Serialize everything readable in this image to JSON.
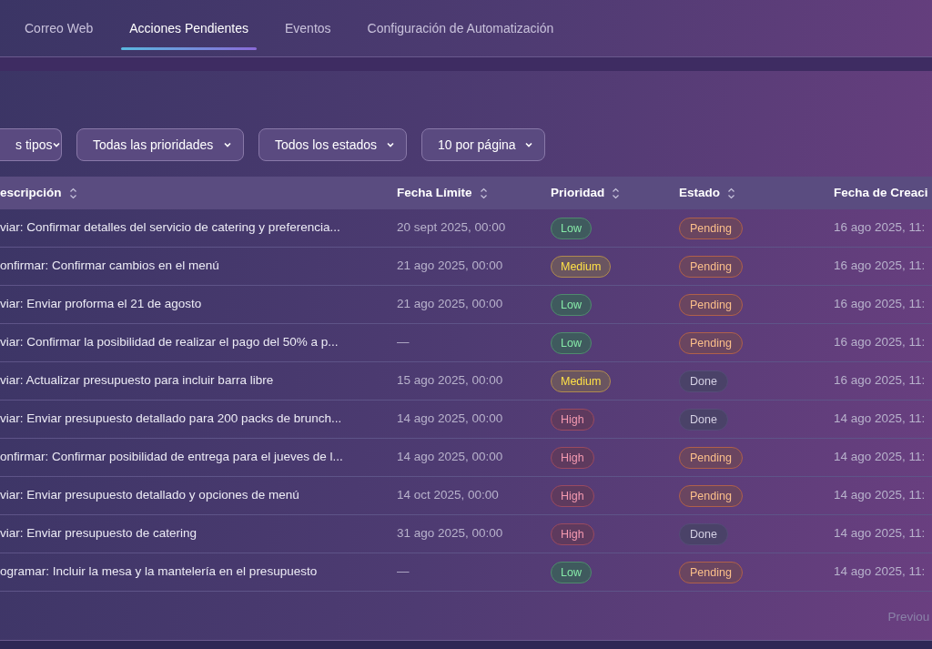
{
  "tabs": [
    {
      "label": "Correo Web",
      "selected": false
    },
    {
      "label": "Acciones Pendientes",
      "selected": true
    },
    {
      "label": "Eventos",
      "selected": false
    },
    {
      "label": "Configuración de Automatización",
      "selected": false
    }
  ],
  "filters": [
    "s tipos",
    "Todas las prioridades",
    "Todos los estados",
    "10 por página"
  ],
  "table": {
    "columns": [
      "escripción",
      "Fecha Límite",
      "Prioridad",
      "Estado",
      "Fecha de Creaci"
    ],
    "rows": [
      {
        "description": "viar: Confirmar detalles del servicio de catering y preferencia...",
        "due": "20 sept 2025, 00:00",
        "priority": {
          "label": "Low",
          "kind": "low"
        },
        "status": {
          "label": "Pending",
          "kind": "pending"
        },
        "created": "16 ago 2025, 11:"
      },
      {
        "description": "onfirmar: Confirmar cambios en el menú",
        "due": "21 ago 2025, 00:00",
        "priority": {
          "label": "Medium",
          "kind": "medium"
        },
        "status": {
          "label": "Pending",
          "kind": "pending"
        },
        "created": "16 ago 2025, 11:"
      },
      {
        "description": "viar: Enviar proforma el 21 de agosto",
        "due": "21 ago 2025, 00:00",
        "priority": {
          "label": "Low",
          "kind": "low"
        },
        "status": {
          "label": "Pending",
          "kind": "pending"
        },
        "created": "16 ago 2025, 11:"
      },
      {
        "description": "viar: Confirmar la posibilidad de realizar el pago del 50% a p...",
        "due": "—",
        "priority": {
          "label": "Low",
          "kind": "low"
        },
        "status": {
          "label": "Pending",
          "kind": "pending"
        },
        "created": "16 ago 2025, 11:"
      },
      {
        "description": "viar: Actualizar presupuesto para incluir barra libre",
        "due": "15 ago 2025, 00:00",
        "priority": {
          "label": "Medium",
          "kind": "medium"
        },
        "status": {
          "label": "Done",
          "kind": "done"
        },
        "created": "16 ago 2025, 11:"
      },
      {
        "description": "viar: Enviar presupuesto detallado para 200 packs de brunch...",
        "due": "14 ago 2025, 00:00",
        "priority": {
          "label": "High",
          "kind": "high"
        },
        "status": {
          "label": "Done",
          "kind": "done"
        },
        "created": "14 ago 2025, 11:"
      },
      {
        "description": "onfirmar: Confirmar posibilidad de entrega para el jueves de l...",
        "due": "14 ago 2025, 00:00",
        "priority": {
          "label": "High",
          "kind": "high"
        },
        "status": {
          "label": "Pending",
          "kind": "pending"
        },
        "created": "14 ago 2025, 11:"
      },
      {
        "description": "viar: Enviar presupuesto detallado y opciones de menú",
        "due": "14 oct 2025, 00:00",
        "priority": {
          "label": "High",
          "kind": "high"
        },
        "status": {
          "label": "Pending",
          "kind": "pending"
        },
        "created": "14 ago 2025, 11:"
      },
      {
        "description": "viar: Enviar presupuesto de catering",
        "due": "31 ago 2025, 00:00",
        "priority": {
          "label": "High",
          "kind": "high"
        },
        "status": {
          "label": "Done",
          "kind": "done"
        },
        "created": "14 ago 2025, 11:"
      },
      {
        "description": "ogramar: Incluir la mesa y la mantelería en el presupuesto",
        "due": "—",
        "priority": {
          "label": "Low",
          "kind": "low"
        },
        "status": {
          "label": "Pending",
          "kind": "pending"
        },
        "created": "14 ago 2025, 11:"
      }
    ]
  },
  "pagination": {
    "label": "Previou",
    "disabled": true
  }
}
